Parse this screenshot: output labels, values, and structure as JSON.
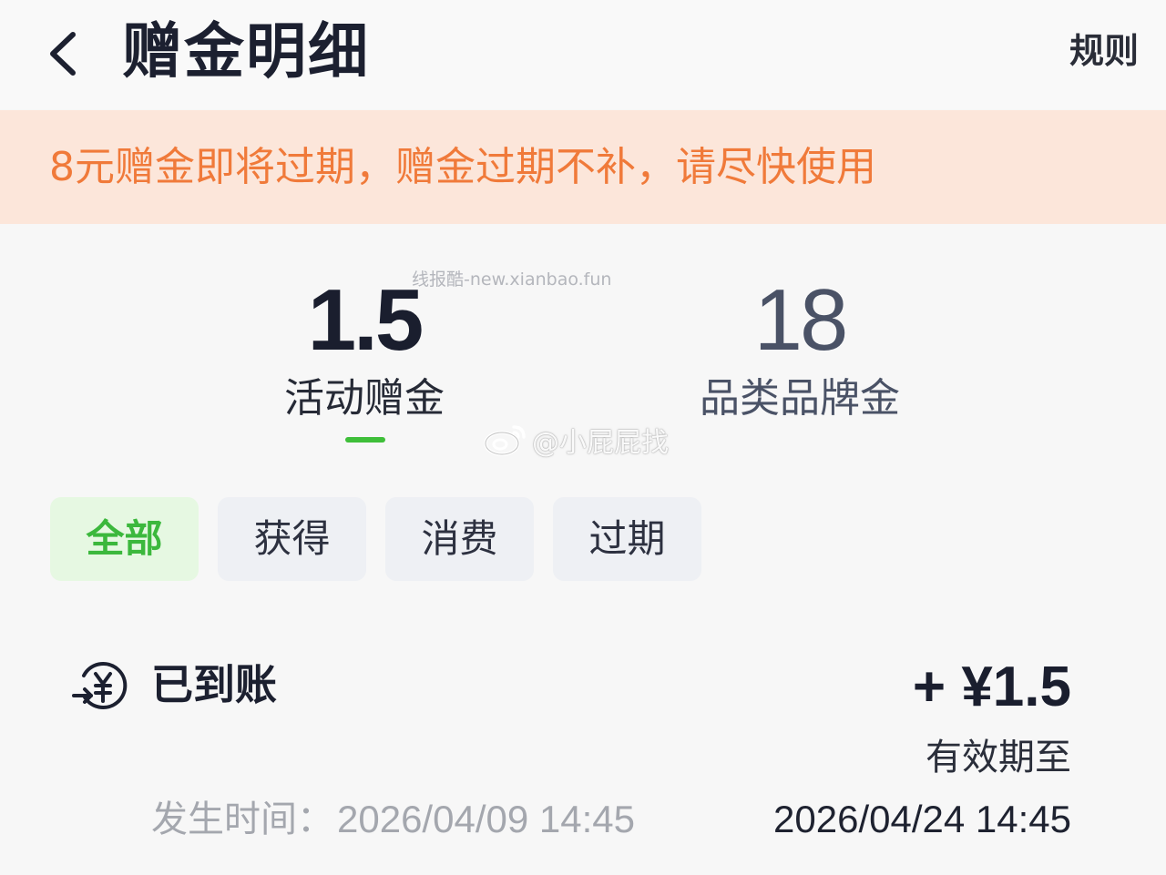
{
  "header": {
    "title": "赠金明细",
    "rules_label": "规则"
  },
  "banner": {
    "text": "8元赠金即将过期，赠金过期不补，请尽快使用",
    "color": "#f07a3a"
  },
  "watermark": {
    "site": "线报酷-new.xianbao.fun",
    "weibo": "@小屁屁找"
  },
  "balances": [
    {
      "amount": "1.5",
      "label": "活动赠金",
      "selected": true
    },
    {
      "amount": "18",
      "label": "品类品牌金",
      "selected": false
    }
  ],
  "filters": [
    {
      "label": "全部",
      "selected": true
    },
    {
      "label": "获得",
      "selected": false
    },
    {
      "label": "消费",
      "selected": false
    },
    {
      "label": "过期",
      "selected": false
    }
  ],
  "record": {
    "icon": "yuan-transfer-icon",
    "status": "已到账",
    "amount": "+ ¥1.5",
    "expiry_label": "有效期至",
    "expiry_value": "2026/04/24 14:45",
    "time_label": "发生时间：",
    "time_value": "2026/04/09 14:45"
  },
  "colors": {
    "accent_green": "#3fbf3a",
    "selected_chip_bg": "#e6f8e2",
    "banner_bg": "#fce6da"
  }
}
